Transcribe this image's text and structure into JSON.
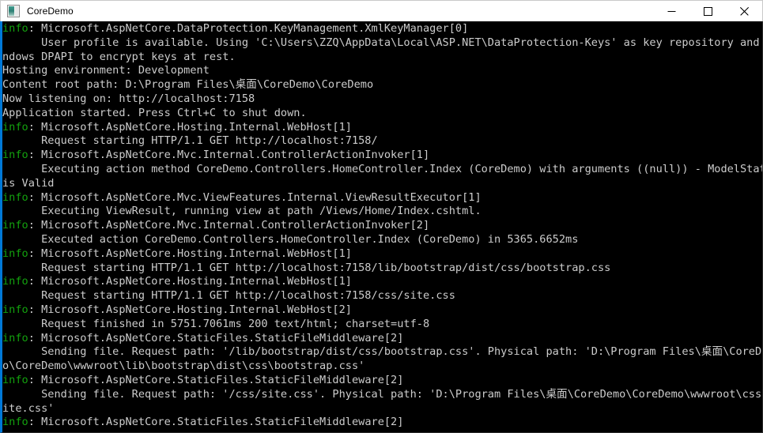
{
  "window": {
    "title": "CoreDemo",
    "icon": "console-app-icon",
    "accent_border_color": "#0078d7",
    "titlebar_bg": "#ffffff",
    "console_bg": "#000000",
    "console_fg": "#cccccc",
    "info_color": "#13a10e",
    "controls": {
      "minimize_label": "Minimize",
      "maximize_label": "Maximize",
      "close_label": "Close"
    }
  },
  "console": {
    "lines": [
      {
        "prefix": "info",
        "text": ": Microsoft.AspNetCore.DataProtection.KeyManagement.XmlKeyManager[0]"
      },
      {
        "prefix": "",
        "text": "      User profile is available. Using 'C:\\Users\\ZZQ\\AppData\\Local\\ASP.NET\\DataProtection-Keys' as key repository and Wi"
      },
      {
        "prefix": "",
        "text": "ndows DPAPI to encrypt keys at rest."
      },
      {
        "prefix": "",
        "text": "Hosting environment: Development"
      },
      {
        "prefix": "",
        "text": "Content root path: D:\\Program Files\\桌面\\CoreDemo\\CoreDemo"
      },
      {
        "prefix": "",
        "text": "Now listening on: http://localhost:7158"
      },
      {
        "prefix": "",
        "text": "Application started. Press Ctrl+C to shut down."
      },
      {
        "prefix": "info",
        "text": ": Microsoft.AspNetCore.Hosting.Internal.WebHost[1]"
      },
      {
        "prefix": "",
        "text": "      Request starting HTTP/1.1 GET http://localhost:7158/"
      },
      {
        "prefix": "info",
        "text": ": Microsoft.AspNetCore.Mvc.Internal.ControllerActionInvoker[1]"
      },
      {
        "prefix": "",
        "text": "      Executing action method CoreDemo.Controllers.HomeController.Index (CoreDemo) with arguments ((null)) - ModelState"
      },
      {
        "prefix": "",
        "text": "is Valid"
      },
      {
        "prefix": "info",
        "text": ": Microsoft.AspNetCore.Mvc.ViewFeatures.Internal.ViewResultExecutor[1]"
      },
      {
        "prefix": "",
        "text": "      Executing ViewResult, running view at path /Views/Home/Index.cshtml."
      },
      {
        "prefix": "info",
        "text": ": Microsoft.AspNetCore.Mvc.Internal.ControllerActionInvoker[2]"
      },
      {
        "prefix": "",
        "text": "      Executed action CoreDemo.Controllers.HomeController.Index (CoreDemo) in 5365.6652ms"
      },
      {
        "prefix": "info",
        "text": ": Microsoft.AspNetCore.Hosting.Internal.WebHost[1]"
      },
      {
        "prefix": "",
        "text": "      Request starting HTTP/1.1 GET http://localhost:7158/lib/bootstrap/dist/css/bootstrap.css"
      },
      {
        "prefix": "info",
        "text": ": Microsoft.AspNetCore.Hosting.Internal.WebHost[1]"
      },
      {
        "prefix": "",
        "text": "      Request starting HTTP/1.1 GET http://localhost:7158/css/site.css"
      },
      {
        "prefix": "info",
        "text": ": Microsoft.AspNetCore.Hosting.Internal.WebHost[2]"
      },
      {
        "prefix": "",
        "text": "      Request finished in 5751.7061ms 200 text/html; charset=utf-8"
      },
      {
        "prefix": "info",
        "text": ": Microsoft.AspNetCore.StaticFiles.StaticFileMiddleware[2]"
      },
      {
        "prefix": "",
        "text": "      Sending file. Request path: '/lib/bootstrap/dist/css/bootstrap.css'. Physical path: 'D:\\Program Files\\桌面\\CoreDem"
      },
      {
        "prefix": "",
        "text": "o\\CoreDemo\\wwwroot\\lib\\bootstrap\\dist\\css\\bootstrap.css'"
      },
      {
        "prefix": "info",
        "text": ": Microsoft.AspNetCore.StaticFiles.StaticFileMiddleware[2]"
      },
      {
        "prefix": "",
        "text": "      Sending file. Request path: '/css/site.css'. Physical path: 'D:\\Program Files\\桌面\\CoreDemo\\CoreDemo\\wwwroot\\css\\s"
      },
      {
        "prefix": "",
        "text": "ite.css'"
      },
      {
        "prefix": "info",
        "text": ": Microsoft.AspNetCore.StaticFiles.StaticFileMiddleware[2]"
      }
    ]
  }
}
